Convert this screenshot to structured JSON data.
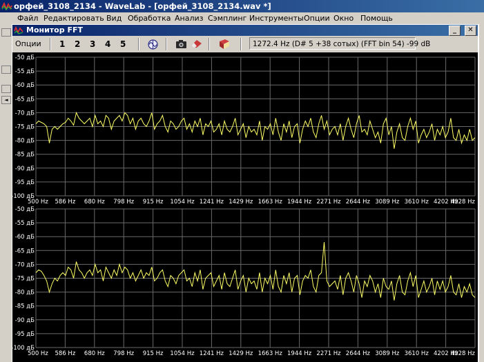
{
  "app": {
    "title": "орфей_3108_2134 - WaveLab - [орфей_3108_2134.wav *]"
  },
  "menu": [
    "Файл",
    "Редактировать",
    "Вид",
    "Обработка",
    "Анализ",
    "Сэмплинг",
    "Инструменты",
    "Опции",
    "Окно",
    "Помощь"
  ],
  "fft_window": {
    "title": "Монитор FFT",
    "minimize_label": "_",
    "close_label": "✕",
    "toolbar": {
      "options_label": "Опции",
      "channels": [
        "1",
        "2",
        "3",
        "4",
        "5"
      ],
      "status": "1272.4 Hz (D# 5 +38 сотых) (FFT bin 54) -99 dB"
    }
  },
  "colors": {
    "plot_bg": "#000000",
    "trace": "#ffff66",
    "grid": "#6a6a6a",
    "axis_text": "#ffffff"
  },
  "chart_data": [
    {
      "type": "line",
      "y_ticks": [
        "-50 дБ",
        "-55 дБ",
        "-60 дБ",
        "-65 дБ",
        "-70 дБ",
        "-75 дБ",
        "-80 дБ",
        "-85 дБ",
        "-90 дБ",
        "-95 дБ",
        "-100 дБ"
      ],
      "x_ticks": [
        "500 Hz",
        "586 Hz",
        "680 Hz",
        "798 Hz",
        "915 Hz",
        "1054 Hz",
        "1241 Hz",
        "1429 Hz",
        "1663 Hz",
        "1944 Hz",
        "2271 Hz",
        "2644 Hz",
        "3089 Hz",
        "3610 Hz",
        "4202 Hz",
        "4928 Hz"
      ],
      "ylim": [
        -100,
        -50
      ],
      "series": [
        {
          "values": [
            -74,
            -73,
            -73.5,
            -74,
            -75,
            -81,
            -76,
            -75,
            -76,
            -75,
            -74,
            -73.5,
            -72,
            -73,
            -74.5,
            -70,
            -72,
            -73,
            -74,
            -73,
            -72,
            -75,
            -71,
            -74,
            -73,
            -75,
            -71,
            -72,
            -76,
            -73,
            -72,
            -71,
            -73,
            -70,
            -71,
            -74,
            -72,
            -76,
            -73,
            -72,
            -74,
            -75,
            -73,
            -70,
            -76,
            -74,
            -73,
            -71,
            -75,
            -77,
            -73,
            -74,
            -76,
            -75,
            -73,
            -72,
            -76,
            -74,
            -77,
            -73,
            -75,
            -72,
            -78,
            -74,
            -75,
            -73,
            -77,
            -76,
            -74,
            -78,
            -73,
            -76,
            -77,
            -75,
            -72,
            -78,
            -76,
            -74,
            -79,
            -75,
            -77,
            -76,
            -78,
            -73,
            -80,
            -75,
            -76,
            -74,
            -78,
            -72,
            -77,
            -80,
            -74,
            -77,
            -73,
            -79,
            -75,
            -74,
            -81,
            -76,
            -73,
            -75,
            -72,
            -77,
            -79,
            -74,
            -71,
            -76,
            -73,
            -78,
            -76,
            -75,
            -78,
            -74,
            -80,
            -75,
            -72,
            -76,
            -79,
            -74,
            -71,
            -77,
            -76,
            -78,
            -73,
            -76,
            -79,
            -77,
            -81,
            -74,
            -72,
            -78,
            -75,
            -83,
            -77,
            -74,
            -79,
            -80,
            -75,
            -72,
            -76,
            -73,
            -81,
            -78,
            -76,
            -79,
            -77,
            -74,
            -80,
            -76,
            -78,
            -75,
            -79,
            -77,
            -72,
            -79,
            -80,
            -76,
            -81,
            -78,
            -80,
            -76,
            -80,
            -79
          ]
        }
      ]
    },
    {
      "type": "line",
      "y_ticks": [
        "-50 дБ",
        "-55 дБ",
        "-60 дБ",
        "-65 дБ",
        "-70 дБ",
        "-75 дБ",
        "-80 дБ",
        "-85 дБ",
        "-90 дБ",
        "-95 дБ",
        "-100 дБ"
      ],
      "x_ticks": [
        "500 Hz",
        "586 Hz",
        "680 Hz",
        "798 Hz",
        "915 Hz",
        "1054 Hz",
        "1241 Hz",
        "1429 Hz",
        "1663 Hz",
        "1944 Hz",
        "2271 Hz",
        "2644 Hz",
        "3089 Hz",
        "3610 Hz",
        "4202 Hz",
        "4928 Hz"
      ],
      "ylim": [
        -100,
        -50
      ],
      "series": [
        {
          "values": [
            -73,
            -72,
            -72.5,
            -74,
            -76,
            -80,
            -77,
            -75,
            -76,
            -74,
            -73,
            -74,
            -71,
            -72,
            -75,
            -69,
            -72,
            -73,
            -75,
            -73,
            -72,
            -74,
            -70,
            -73,
            -72,
            -76,
            -71,
            -73,
            -75,
            -72,
            -74,
            -70,
            -73,
            -71,
            -72,
            -75,
            -73,
            -76,
            -74,
            -72,
            -75,
            -73,
            -74,
            -71,
            -76,
            -75,
            -73,
            -72,
            -76,
            -78,
            -74,
            -75,
            -77,
            -74,
            -73,
            -72,
            -76,
            -75,
            -78,
            -73,
            -76,
            -72,
            -79,
            -75,
            -74,
            -73,
            -78,
            -76,
            -74,
            -79,
            -73,
            -77,
            -78,
            -75,
            -72,
            -79,
            -76,
            -74,
            -80,
            -75,
            -77,
            -76,
            -79,
            -73,
            -80,
            -75,
            -77,
            -74,
            -79,
            -72,
            -78,
            -80,
            -74,
            -77,
            -73,
            -80,
            -75,
            -74,
            -81,
            -76,
            -74,
            -75,
            -72,
            -78,
            -80,
            -74,
            -73,
            -62,
            -76,
            -78,
            -77,
            -76,
            -79,
            -74,
            -81,
            -75,
            -73,
            -76,
            -80,
            -74,
            -77,
            -82,
            -76,
            -78,
            -74,
            -76,
            -80,
            -77,
            -82,
            -75,
            -78,
            -79,
            -76,
            -83,
            -77,
            -74,
            -80,
            -81,
            -76,
            -73,
            -78,
            -74,
            -82,
            -79,
            -76,
            -80,
            -78,
            -75,
            -81,
            -76,
            -79,
            -76,
            -80,
            -78,
            -74,
            -80,
            -81,
            -77,
            -82,
            -78,
            -80,
            -77,
            -81,
            -82
          ]
        }
      ]
    }
  ]
}
